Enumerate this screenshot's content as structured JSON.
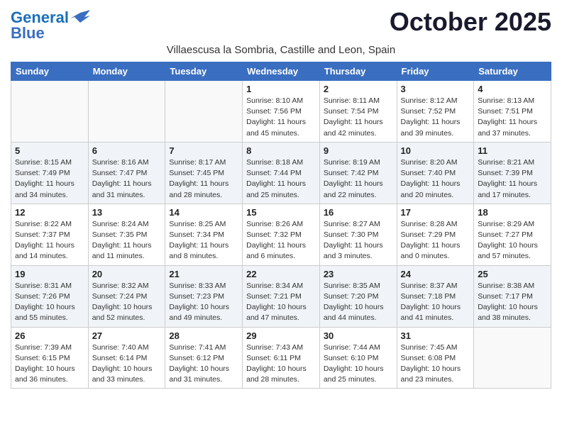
{
  "logo": {
    "line1": "General",
    "line2": "Blue"
  },
  "title": "October 2025",
  "subtitle": "Villaescusa la Sombria, Castille and Leon, Spain",
  "headers": [
    "Sunday",
    "Monday",
    "Tuesday",
    "Wednesday",
    "Thursday",
    "Friday",
    "Saturday"
  ],
  "weeks": [
    [
      {
        "day": "",
        "info": ""
      },
      {
        "day": "",
        "info": ""
      },
      {
        "day": "",
        "info": ""
      },
      {
        "day": "1",
        "info": "Sunrise: 8:10 AM\nSunset: 7:56 PM\nDaylight: 11 hours\nand 45 minutes."
      },
      {
        "day": "2",
        "info": "Sunrise: 8:11 AM\nSunset: 7:54 PM\nDaylight: 11 hours\nand 42 minutes."
      },
      {
        "day": "3",
        "info": "Sunrise: 8:12 AM\nSunset: 7:52 PM\nDaylight: 11 hours\nand 39 minutes."
      },
      {
        "day": "4",
        "info": "Sunrise: 8:13 AM\nSunset: 7:51 PM\nDaylight: 11 hours\nand 37 minutes."
      }
    ],
    [
      {
        "day": "5",
        "info": "Sunrise: 8:15 AM\nSunset: 7:49 PM\nDaylight: 11 hours\nand 34 minutes."
      },
      {
        "day": "6",
        "info": "Sunrise: 8:16 AM\nSunset: 7:47 PM\nDaylight: 11 hours\nand 31 minutes."
      },
      {
        "day": "7",
        "info": "Sunrise: 8:17 AM\nSunset: 7:45 PM\nDaylight: 11 hours\nand 28 minutes."
      },
      {
        "day": "8",
        "info": "Sunrise: 8:18 AM\nSunset: 7:44 PM\nDaylight: 11 hours\nand 25 minutes."
      },
      {
        "day": "9",
        "info": "Sunrise: 8:19 AM\nSunset: 7:42 PM\nDaylight: 11 hours\nand 22 minutes."
      },
      {
        "day": "10",
        "info": "Sunrise: 8:20 AM\nSunset: 7:40 PM\nDaylight: 11 hours\nand 20 minutes."
      },
      {
        "day": "11",
        "info": "Sunrise: 8:21 AM\nSunset: 7:39 PM\nDaylight: 11 hours\nand 17 minutes."
      }
    ],
    [
      {
        "day": "12",
        "info": "Sunrise: 8:22 AM\nSunset: 7:37 PM\nDaylight: 11 hours\nand 14 minutes."
      },
      {
        "day": "13",
        "info": "Sunrise: 8:24 AM\nSunset: 7:35 PM\nDaylight: 11 hours\nand 11 minutes."
      },
      {
        "day": "14",
        "info": "Sunrise: 8:25 AM\nSunset: 7:34 PM\nDaylight: 11 hours\nand 8 minutes."
      },
      {
        "day": "15",
        "info": "Sunrise: 8:26 AM\nSunset: 7:32 PM\nDaylight: 11 hours\nand 6 minutes."
      },
      {
        "day": "16",
        "info": "Sunrise: 8:27 AM\nSunset: 7:30 PM\nDaylight: 11 hours\nand 3 minutes."
      },
      {
        "day": "17",
        "info": "Sunrise: 8:28 AM\nSunset: 7:29 PM\nDaylight: 11 hours\nand 0 minutes."
      },
      {
        "day": "18",
        "info": "Sunrise: 8:29 AM\nSunset: 7:27 PM\nDaylight: 10 hours\nand 57 minutes."
      }
    ],
    [
      {
        "day": "19",
        "info": "Sunrise: 8:31 AM\nSunset: 7:26 PM\nDaylight: 10 hours\nand 55 minutes."
      },
      {
        "day": "20",
        "info": "Sunrise: 8:32 AM\nSunset: 7:24 PM\nDaylight: 10 hours\nand 52 minutes."
      },
      {
        "day": "21",
        "info": "Sunrise: 8:33 AM\nSunset: 7:23 PM\nDaylight: 10 hours\nand 49 minutes."
      },
      {
        "day": "22",
        "info": "Sunrise: 8:34 AM\nSunset: 7:21 PM\nDaylight: 10 hours\nand 47 minutes."
      },
      {
        "day": "23",
        "info": "Sunrise: 8:35 AM\nSunset: 7:20 PM\nDaylight: 10 hours\nand 44 minutes."
      },
      {
        "day": "24",
        "info": "Sunrise: 8:37 AM\nSunset: 7:18 PM\nDaylight: 10 hours\nand 41 minutes."
      },
      {
        "day": "25",
        "info": "Sunrise: 8:38 AM\nSunset: 7:17 PM\nDaylight: 10 hours\nand 38 minutes."
      }
    ],
    [
      {
        "day": "26",
        "info": "Sunrise: 7:39 AM\nSunset: 6:15 PM\nDaylight: 10 hours\nand 36 minutes."
      },
      {
        "day": "27",
        "info": "Sunrise: 7:40 AM\nSunset: 6:14 PM\nDaylight: 10 hours\nand 33 minutes."
      },
      {
        "day": "28",
        "info": "Sunrise: 7:41 AM\nSunset: 6:12 PM\nDaylight: 10 hours\nand 31 minutes."
      },
      {
        "day": "29",
        "info": "Sunrise: 7:43 AM\nSunset: 6:11 PM\nDaylight: 10 hours\nand 28 minutes."
      },
      {
        "day": "30",
        "info": "Sunrise: 7:44 AM\nSunset: 6:10 PM\nDaylight: 10 hours\nand 25 minutes."
      },
      {
        "day": "31",
        "info": "Sunrise: 7:45 AM\nSunset: 6:08 PM\nDaylight: 10 hours\nand 23 minutes."
      },
      {
        "day": "",
        "info": ""
      }
    ]
  ]
}
